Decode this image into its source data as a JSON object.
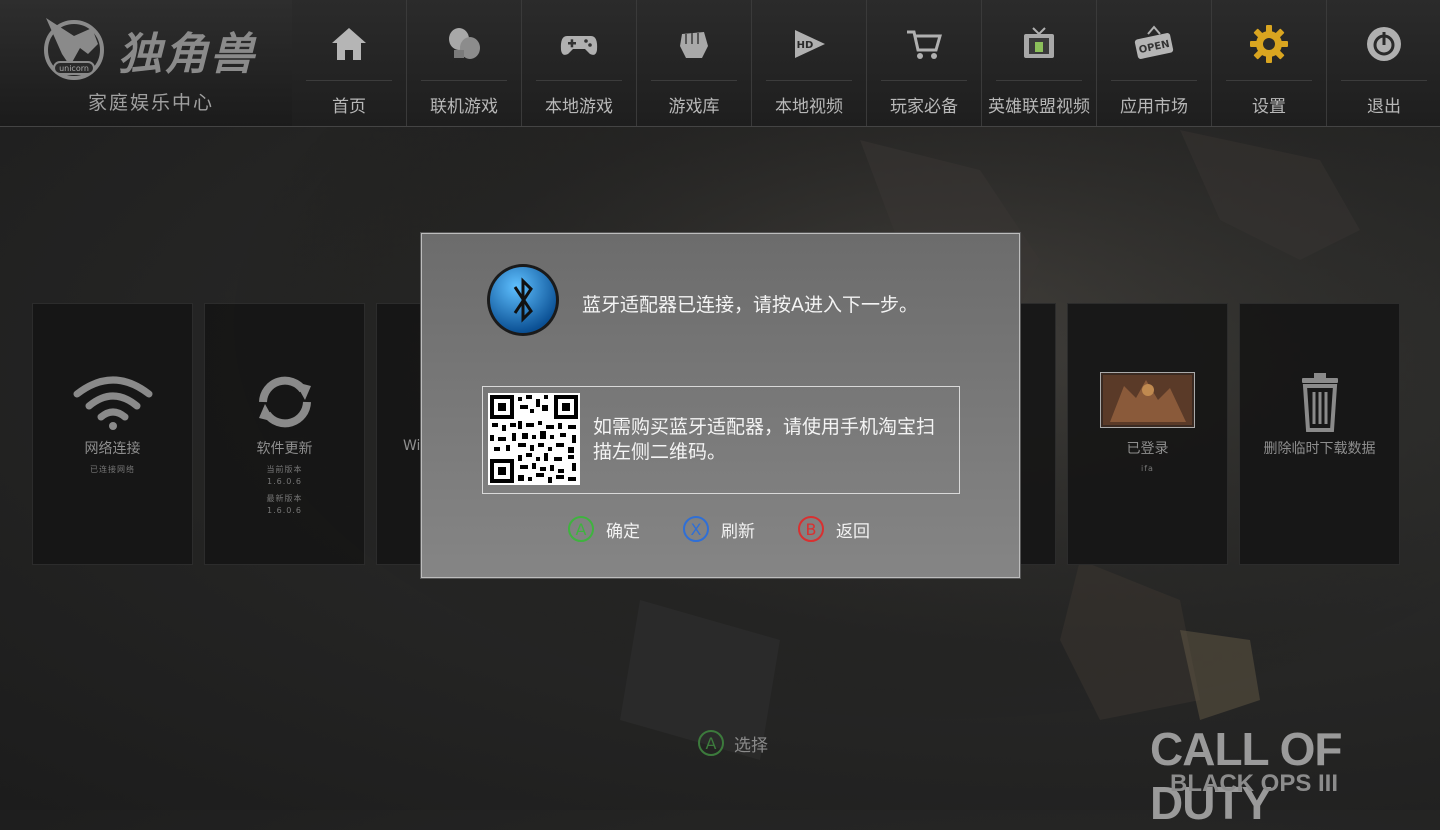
{
  "brand": {
    "name": "独角兽",
    "subtitle": "家庭娱乐中心",
    "logo_text": "unicorn"
  },
  "nav": [
    {
      "label": "首页",
      "icon": "home-icon"
    },
    {
      "label": "联机游戏",
      "icon": "boxing-gloves-icon"
    },
    {
      "label": "本地游戏",
      "icon": "gamepad-icon"
    },
    {
      "label": "游戏库",
      "icon": "fist-icon"
    },
    {
      "label": "本地视频",
      "icon": "hd-video-icon"
    },
    {
      "label": "玩家必备",
      "icon": "shopping-cart-icon"
    },
    {
      "label": "英雄联盟视频",
      "icon": "tv-icon"
    },
    {
      "label": "应用市场",
      "icon": "open-sign-icon"
    },
    {
      "label": "设置",
      "icon": "gear-icon",
      "active": true
    },
    {
      "label": "退出",
      "icon": "power-icon"
    }
  ],
  "cards": [
    {
      "title": "网络连接",
      "sub": [
        "已连接网络"
      ],
      "icon": "wifi-icon"
    },
    {
      "title": "软件更新",
      "sub": [
        "当前版本",
        "1.6.0.6",
        "最新版本",
        "1.6.0.6"
      ],
      "icon": "refresh-icon"
    },
    {
      "title": "Wi",
      "icon": "wifi-hotspot-icon"
    },
    {
      "title": "已登录",
      "sub": [
        "ifa"
      ],
      "icon": "profile-image-icon"
    },
    {
      "title": "删除临时下载数据",
      "icon": "trash-icon"
    }
  ],
  "dialog": {
    "message": "蓝牙适配器已连接，请按A进入下一步。",
    "qr_text": "如需购买蓝牙适配器，请使用手机淘宝扫描左侧二维码。",
    "buttons": [
      {
        "key": "A",
        "label": "确定",
        "color": "#3fb33f"
      },
      {
        "key": "X",
        "label": "刷新",
        "color": "#2f6fd6"
      },
      {
        "key": "B",
        "label": "返回",
        "color": "#d93030"
      }
    ]
  },
  "hint": {
    "key": "A",
    "label": "选择"
  },
  "game_logo": {
    "line1": "CALL OF DUTY",
    "line2": "BLACK OPS III"
  },
  "colors": {
    "accent_gear": "#d9a520",
    "bluetooth": "#1b7fd0"
  }
}
